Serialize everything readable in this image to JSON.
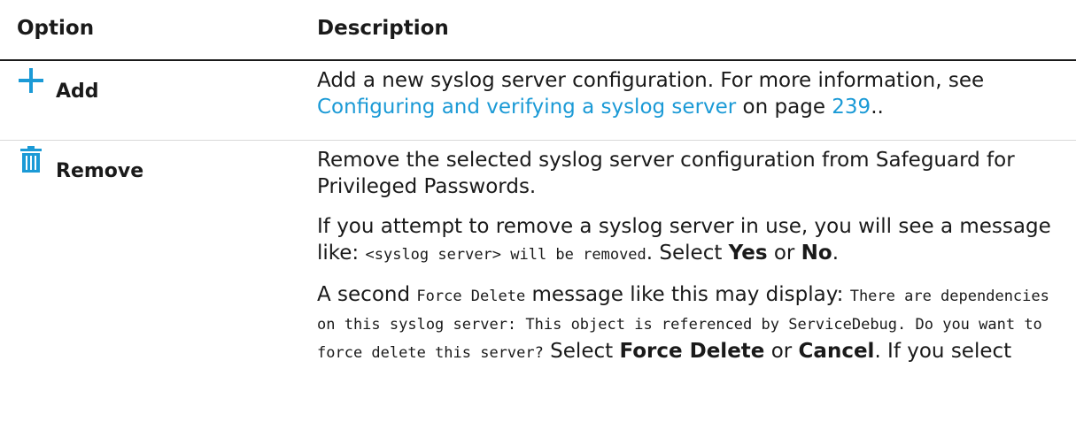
{
  "header": {
    "option": "Option",
    "description": "Description"
  },
  "rows": [
    {
      "icon": "plus-icon",
      "label": "Add",
      "desc": {
        "text1": "Add a new syslog server configuration. For more information, see ",
        "link_text": "Configuring and verifying a syslog server",
        "text2": " on page ",
        "page_link": "239",
        "text3": ".."
      }
    },
    {
      "icon": "trash-icon",
      "label": "Remove",
      "desc": {
        "p1": "Remove the selected syslog server configuration from Safeguard for Privileged Passwords.",
        "p2_a": "If you attempt to remove a syslog server in use, you will see a message like: ",
        "p2_code": "<syslog server> will be removed",
        "p2_b": ". Select ",
        "p2_yes": "Yes",
        "p2_c": " or ",
        "p2_no": "No",
        "p2_d": ".",
        "p3_a": "A second ",
        "p3_code1": "Force Delete",
        "p3_b": " message like this may display: ",
        "p3_code2": "There are dependencies on this syslog server: This object is referenced by ServiceDebug. Do you want to force delete this server?",
        "p3_c": " Select ",
        "p3_force": "Force Delete",
        "p3_d": " or ",
        "p3_cancel": "Cancel",
        "p3_e": ". If you select"
      }
    }
  ],
  "colors": {
    "accent": "#1b9ad6",
    "text": "#1a1a1a"
  }
}
